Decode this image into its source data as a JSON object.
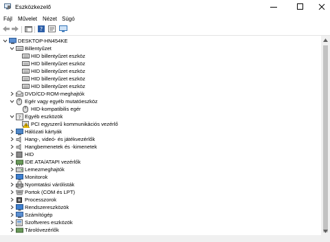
{
  "window": {
    "title": "Eszközkezelő"
  },
  "menu": [
    "Fájl",
    "Művelet",
    "Nézet",
    "Súgó"
  ],
  "tree": [
    {
      "label": "DESKTOP-HN454KE",
      "icon": "computer-icon",
      "expander": "open"
    },
    {
      "label": "Billentyűzet",
      "icon": "keyboard-icon",
      "expander": "open"
    },
    {
      "label": "HID billentyűzet eszköz",
      "icon": "keyboard-icon",
      "expander": "none"
    },
    {
      "label": "HID billentyűzet eszköz",
      "icon": "keyboard-icon",
      "expander": "none"
    },
    {
      "label": "HID billentyűzet eszköz",
      "icon": "keyboard-icon",
      "expander": "none"
    },
    {
      "label": "HID billentyűzet eszköz",
      "icon": "keyboard-icon",
      "expander": "none"
    },
    {
      "label": "HID billentyűzet eszköz",
      "icon": "keyboard-icon",
      "expander": "none"
    },
    {
      "label": "DVD/CD-ROM-meghajtók",
      "icon": "dvd-drive-icon",
      "expander": "closed"
    },
    {
      "label": "Egér vagy egyéb mutatóeszköz",
      "icon": "mouse-icon",
      "expander": "open"
    },
    {
      "label": "HID-kompatibilis egér",
      "icon": "mouse-icon",
      "expander": "none"
    },
    {
      "label": "Egyéb eszközök",
      "icon": "unknown-device-icon",
      "expander": "open"
    },
    {
      "label": "PCI egyszerű kommunikációs vezérlő",
      "icon": "warning-device-icon",
      "expander": "none"
    },
    {
      "label": "Hálózati kártyák",
      "icon": "network-adapter-icon",
      "expander": "closed"
    },
    {
      "label": "Hang-, videó- és játékvezérlők",
      "icon": "speaker-icon",
      "expander": "closed"
    },
    {
      "label": "Hangbemenetek és -kimenetek",
      "icon": "speaker-icon",
      "expander": "closed"
    },
    {
      "label": "HID",
      "icon": "hid-icon",
      "expander": "closed"
    },
    {
      "label": "IDE ATA/ATAPI vezérlők",
      "icon": "ide-controller-icon",
      "expander": "closed"
    },
    {
      "label": "Lemezmeghajtók",
      "icon": "disk-drive-icon",
      "expander": "closed"
    },
    {
      "label": "Monitorok",
      "icon": "monitor-icon",
      "expander": "closed"
    },
    {
      "label": "Nyomtatási várólisták",
      "icon": "printer-icon",
      "expander": "closed"
    },
    {
      "label": "Portok (COM és LPT)",
      "icon": "port-icon",
      "expander": "closed"
    },
    {
      "label": "Processzorok",
      "icon": "processor-icon",
      "expander": "closed"
    },
    {
      "label": "Rendszereszközök",
      "icon": "system-device-icon",
      "expander": "closed"
    },
    {
      "label": "Számítógép",
      "icon": "computer-icon",
      "expander": "closed"
    },
    {
      "label": "Szoftveres eszközök",
      "icon": "software-device-icon",
      "expander": "closed"
    },
    {
      "label": "Tárolóvezérlők",
      "icon": "storage-controller-icon",
      "expander": "closed"
    }
  ]
}
